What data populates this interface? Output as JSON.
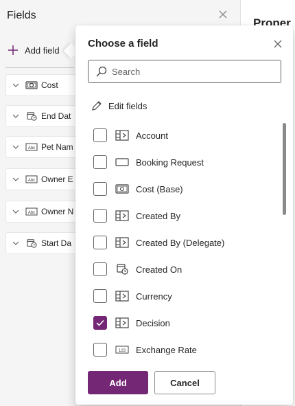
{
  "fields_pane": {
    "title": "Fields",
    "add_field_label": "Add field",
    "items": [
      {
        "label": "Cost",
        "icon": "currency-icon"
      },
      {
        "label": "End Dat",
        "icon": "calendar-clock-icon"
      },
      {
        "label": "Pet Nam",
        "icon": "text-abc-icon"
      },
      {
        "label": "Owner E",
        "icon": "text-abc-icon"
      },
      {
        "label": "Owner N",
        "icon": "text-abc-icon"
      },
      {
        "label": "Start Da",
        "icon": "calendar-clock-icon"
      }
    ]
  },
  "properties_pane": {
    "title": "Proper"
  },
  "popup": {
    "title": "Choose a field",
    "search_placeholder": "Search",
    "edit_fields_label": "Edit fields",
    "options": [
      {
        "label": "Account",
        "icon": "lookup-icon",
        "checked": false
      },
      {
        "label": "Booking Request",
        "icon": "single-line-icon",
        "checked": false
      },
      {
        "label": "Cost (Base)",
        "icon": "currency-icon",
        "checked": false
      },
      {
        "label": "Created By",
        "icon": "lookup-icon",
        "checked": false
      },
      {
        "label": "Created By (Delegate)",
        "icon": "lookup-icon",
        "checked": false
      },
      {
        "label": "Created On",
        "icon": "calendar-clock-icon",
        "checked": false
      },
      {
        "label": "Currency",
        "icon": "lookup-icon",
        "checked": false
      },
      {
        "label": "Decision",
        "icon": "lookup-icon",
        "checked": true
      },
      {
        "label": "Exchange Rate",
        "icon": "number-123-icon",
        "checked": false
      }
    ],
    "add_button": "Add",
    "cancel_button": "Cancel"
  },
  "colors": {
    "accent": "#742774",
    "pane_bg": "#f5f5f5"
  }
}
